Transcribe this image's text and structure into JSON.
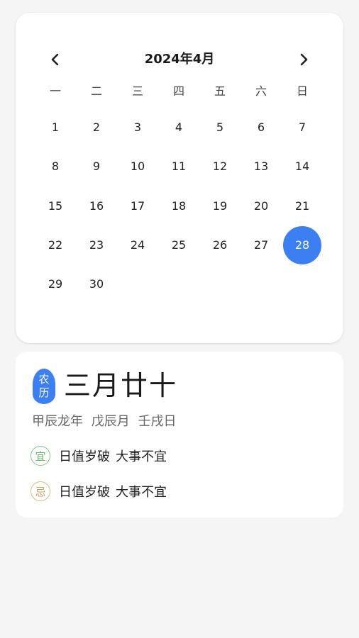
{
  "calendar": {
    "month_title": "2024年4月",
    "weekdays": [
      "一",
      "二",
      "三",
      "四",
      "五",
      "六",
      "日"
    ],
    "days": [
      "1",
      "2",
      "3",
      "4",
      "5",
      "6",
      "7",
      "8",
      "9",
      "10",
      "11",
      "12",
      "13",
      "14",
      "15",
      "16",
      "17",
      "18",
      "19",
      "20",
      "21",
      "22",
      "23",
      "24",
      "25",
      "26",
      "27",
      "28",
      "29",
      "30"
    ],
    "selected_day": "28",
    "accent_color": "#3b7ff2"
  },
  "lunar": {
    "badge_top": "农",
    "badge_bottom": "历",
    "date": "三月廿十",
    "ganzhi": {
      "year": "甲辰龙年",
      "month": "戊辰月",
      "day": "壬戌日"
    },
    "yi": {
      "icon_label": "宜",
      "text_1": "日值岁破",
      "text_2": "大事不宜"
    },
    "ji": {
      "icon_label": "忌",
      "text_1": "日值岁破",
      "text_2": "大事不宜"
    }
  }
}
